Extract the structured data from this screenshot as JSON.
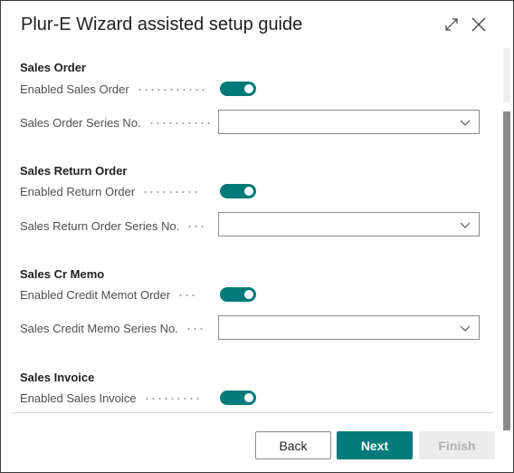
{
  "dialog": {
    "title": "Plur-E Wizard assisted setup guide"
  },
  "sections": [
    {
      "title": "Sales Order",
      "toggle_label": "Enabled Sales Order",
      "toggle_on": true,
      "series_label": "Sales Order Series No.",
      "series_value": ""
    },
    {
      "title": "Sales Return Order",
      "toggle_label": "Enabled Return Order",
      "toggle_on": true,
      "series_label": "Sales Return Order Series No.",
      "series_value": ""
    },
    {
      "title": "Sales Cr Memo",
      "toggle_label": "Enabled Credit Memot Order",
      "toggle_on": true,
      "series_label": "Sales Credit Memo Series No.",
      "series_value": ""
    },
    {
      "title": "Sales Invoice",
      "toggle_label": "Enabled Sales Invoice",
      "toggle_on": true
    }
  ],
  "footer": {
    "back_label": "Back",
    "next_label": "Next",
    "finish_label": "Finish"
  },
  "icons": {
    "expand": "expand-icon",
    "close": "close-icon",
    "dropdown": "chevron-down-icon"
  },
  "colors": {
    "accent": "#007a7a",
    "disabled_bg": "#ececec",
    "disabled_text": "#b0b0b0"
  }
}
